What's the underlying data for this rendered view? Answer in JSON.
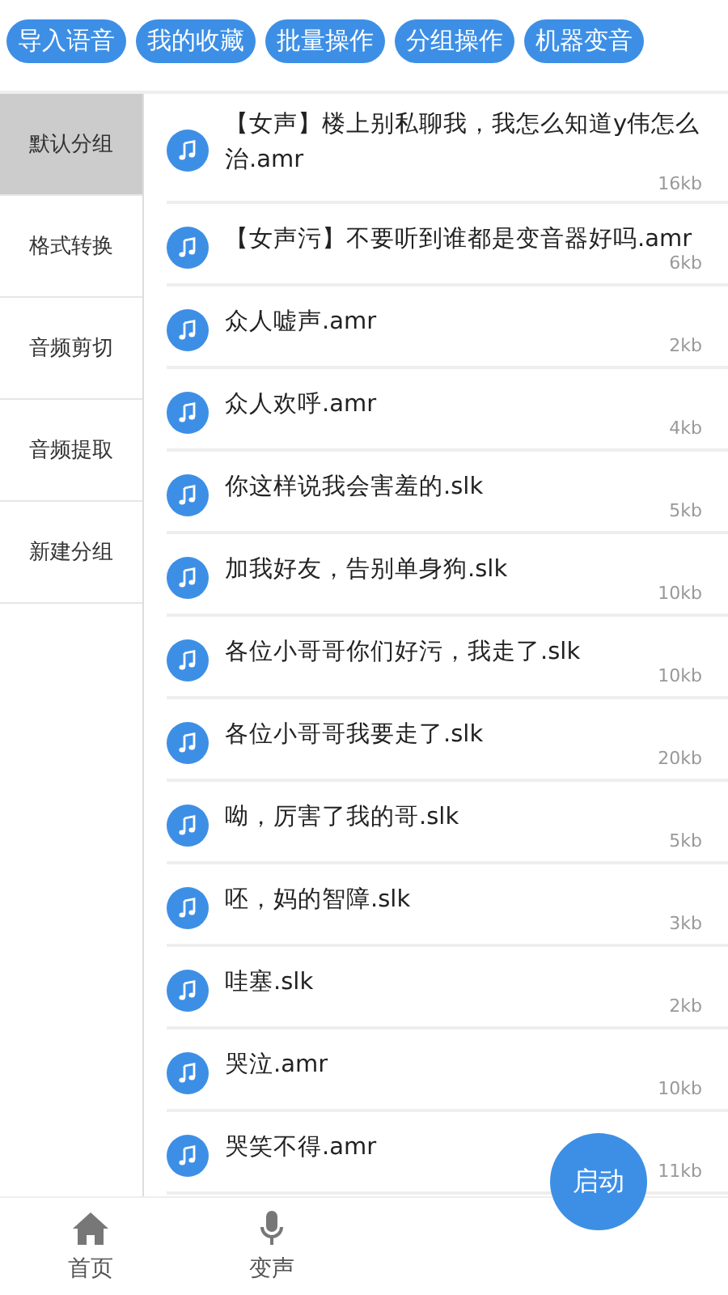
{
  "top_buttons": [
    "导入语音",
    "我的收藏",
    "批量操作",
    "分组操作",
    "机器变音"
  ],
  "groups": [
    {
      "label": "默认分组",
      "selected": true
    },
    {
      "label": "格式转换",
      "selected": false
    },
    {
      "label": "音频剪切",
      "selected": false
    },
    {
      "label": "音频提取",
      "selected": false
    },
    {
      "label": "新建分组",
      "selected": false
    }
  ],
  "files": [
    {
      "name": "【女声】楼上别私聊我，我怎么知道y伟怎么治.amr",
      "size": "16kb"
    },
    {
      "name": "【女声污】不要听到谁都是变音器好吗.amr",
      "size": "6kb"
    },
    {
      "name": "众人嘘声.amr",
      "size": "2kb"
    },
    {
      "name": "众人欢呼.amr",
      "size": "4kb"
    },
    {
      "name": "你这样说我会害羞的.slk",
      "size": "5kb"
    },
    {
      "name": "加我好友，告别单身狗.slk",
      "size": "10kb"
    },
    {
      "name": "各位小哥哥你们好污，我走了.slk",
      "size": "10kb"
    },
    {
      "name": "各位小哥哥我要走了.slk",
      "size": "20kb"
    },
    {
      "name": "呦，厉害了我的哥.slk",
      "size": "5kb"
    },
    {
      "name": "呸，妈的智障.slk",
      "size": "3kb"
    },
    {
      "name": "哇塞.slk",
      "size": "2kb"
    },
    {
      "name": "哭泣.amr",
      "size": "10kb"
    },
    {
      "name": "哭笑不得.amr",
      "size": "11kb"
    }
  ],
  "fab": "启动",
  "nav": [
    {
      "label": "首页",
      "kind": "home"
    },
    {
      "label": "变声",
      "kind": "mic"
    }
  ]
}
